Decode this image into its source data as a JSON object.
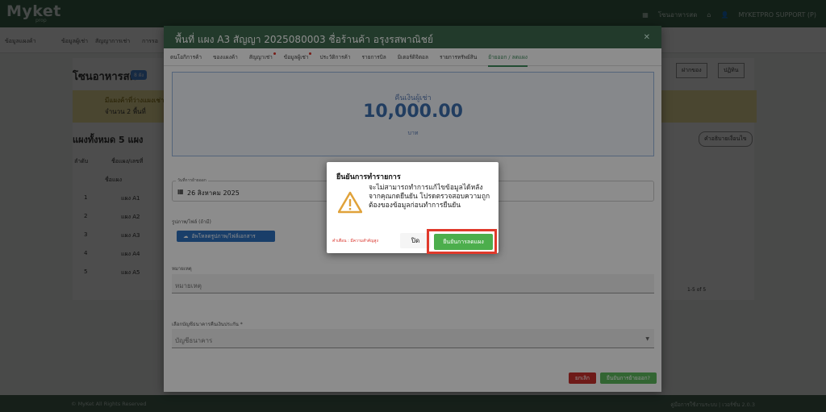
{
  "app": {
    "logo": "Myket",
    "logo_sub": "prop",
    "top_right": {
      "user1": "โซนอาหารสด",
      "support": "MYKETPRO SUPPORT (P)"
    }
  },
  "background": {
    "nav_tabs": [
      "ข้อมูลแผงค้า",
      "ข้อมูลผู้เช่า",
      "สัญญาการเช่า",
      "การรอ"
    ],
    "title": "โซนอาหารสด",
    "badge": "8 ผัง",
    "promo_line1": "มีแผงค้าที่ว่างแผงเช่า",
    "promo_line2": "จำนวน 2 พื้นที่",
    "stall_total": "แผงทั้งหมด 5 แผง",
    "col_order": "ลำดับ",
    "col_stall": "ชื่อแผง/เลขที่",
    "col_stall_name": "ชื่อแผง",
    "rows": [
      {
        "no": "1",
        "name": "แผง A1"
      },
      {
        "no": "2",
        "name": "แผง A2"
      },
      {
        "no": "3",
        "name": "แผง A3"
      },
      {
        "no": "4",
        "name": "แผง A4"
      },
      {
        "no": "5",
        "name": "แผง A5"
      }
    ],
    "pagination": "1-5 of 5",
    "btn_deposit": "ฝากของ",
    "btn_calendar": "ปฏิทิน",
    "btn_cond": "คำอธิบายเงื่อนไข",
    "footer_left": "© MyKet All Rights Reserved",
    "footer_right": "คู่มือการใช้งานระบบ | เวอร์ชั่น 2.0.3"
  },
  "modal": {
    "title": "พื้นที่ แผง A3 สัญญา 2025080003 ชื่อร้านค้า อรุงรสพาณิชย์",
    "tabs": [
      {
        "label": "ตนโอกิการค้า",
        "dot": false
      },
      {
        "label": "ของแผงค้า",
        "dot": false
      },
      {
        "label": "สัญญาเช่า",
        "dot": true
      },
      {
        "label": "ข้อมูลผู้เช่า",
        "dot": true
      },
      {
        "label": "ประวัติการค้า",
        "dot": false
      },
      {
        "label": "รายการบิล",
        "dot": false
      },
      {
        "label": "มิเตอร์ดิจิตอล",
        "dot": false
      },
      {
        "label": "รายการทรัพย์สิน",
        "dot": false
      },
      {
        "label": "ย้ายออก / ลดแผง",
        "dot": false,
        "active": true
      }
    ],
    "refund_label": "คืนเงินผู้เช่า",
    "refund_amount": "10,000.00",
    "refund_unit": "บาท",
    "date_label": "วันที่การย้ายออก",
    "date_value": "26 สิงหาคม 2025",
    "file_label": "รูปภาพ/ไฟล์ (ถ้ามี)",
    "upload_label": "อัพโหลดรูปภาพ/ไฟล์เอกสาร",
    "note_label": "หมายเหตุ",
    "note_placeholder": "หมายเหตุ",
    "bank_label": "เลือกบัญชีธนาคารคืนเงินประกัน *",
    "bank_value": "บัญชีธนาคาร",
    "cancel": "ยกเลิก",
    "confirm": "ยืนยันการย้ายออก?"
  },
  "dialog": {
    "title": "ยืนยันการทำรายการ",
    "message": "จะไม่สามารถทำการแก้ไขข้อมูลได้หลังจากคุณกดยืนยัน โปรดตรวจสอบความถูกต้องของข้อมูลก่อนทำการยืนยัน",
    "note": "คำเตือน : มีความสำคัญสูง",
    "close": "ปิด",
    "confirm": "ยืนยันการลดแผง"
  }
}
